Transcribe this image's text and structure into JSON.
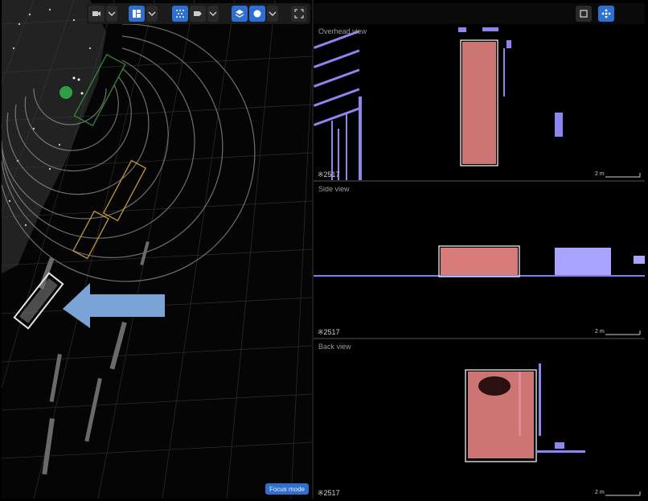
{
  "toolbar_left": {
    "buttons": [
      {
        "name": "camera-icon",
        "active": false
      },
      {
        "name": "chevron-down-icon",
        "active": false
      },
      {
        "name": "grid-layout-icon",
        "active": true
      },
      {
        "name": "chevron-down-icon",
        "active": false
      },
      {
        "name": "point-cloud-icon",
        "active": true
      },
      {
        "name": "label-tag-icon",
        "active": false
      },
      {
        "name": "chevron-down-icon",
        "active": false
      },
      {
        "name": "layers-icon",
        "active": true
      },
      {
        "name": "circle-icon",
        "active": true
      },
      {
        "name": "chevron-down-icon",
        "active": false
      },
      {
        "name": "fullscreen-icon",
        "active": false
      }
    ]
  },
  "toolbar_right": {
    "buttons": [
      {
        "name": "square-icon",
        "active": false
      },
      {
        "name": "move-crosshair-icon",
        "active": true
      }
    ]
  },
  "panels": {
    "overhead": {
      "title": "Overhead view",
      "count": "2517",
      "scale": "2 m"
    },
    "side": {
      "title": "Side view",
      "count": "2517",
      "scale": "2 m"
    },
    "back": {
      "title": "Back view",
      "count": "2517",
      "scale": "2 m"
    }
  },
  "main_view": {
    "focus_button": "Focus mode"
  },
  "colors": {
    "accent": "#2d6fd2",
    "box_green": "#2e8b3a",
    "box_yellow": "#c49a2a",
    "box_white": "#e5e5e5",
    "arrow": "#7aa3d6",
    "points_pink": "#f08a86",
    "points_lavender": "#a9a4ff"
  }
}
